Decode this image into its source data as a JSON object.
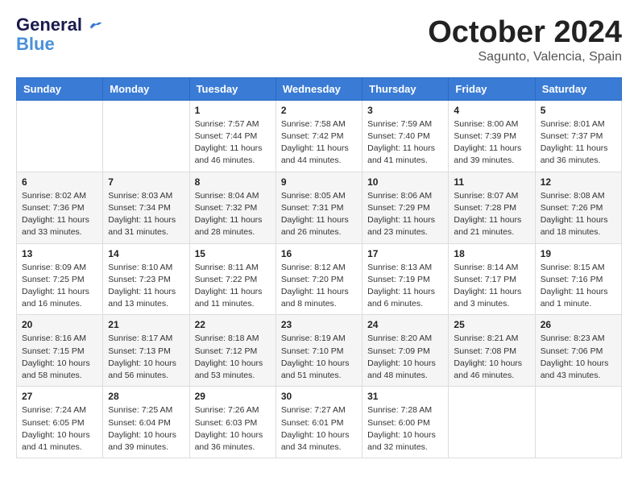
{
  "header": {
    "logo_line1": "General",
    "logo_line2": "Blue",
    "month": "October 2024",
    "location": "Sagunto, Valencia, Spain"
  },
  "weekdays": [
    "Sunday",
    "Monday",
    "Tuesday",
    "Wednesday",
    "Thursday",
    "Friday",
    "Saturday"
  ],
  "weeks": [
    [
      {
        "day": "",
        "info": ""
      },
      {
        "day": "",
        "info": ""
      },
      {
        "day": "1",
        "info": "Sunrise: 7:57 AM\nSunset: 7:44 PM\nDaylight: 11 hours and 46 minutes."
      },
      {
        "day": "2",
        "info": "Sunrise: 7:58 AM\nSunset: 7:42 PM\nDaylight: 11 hours and 44 minutes."
      },
      {
        "day": "3",
        "info": "Sunrise: 7:59 AM\nSunset: 7:40 PM\nDaylight: 11 hours and 41 minutes."
      },
      {
        "day": "4",
        "info": "Sunrise: 8:00 AM\nSunset: 7:39 PM\nDaylight: 11 hours and 39 minutes."
      },
      {
        "day": "5",
        "info": "Sunrise: 8:01 AM\nSunset: 7:37 PM\nDaylight: 11 hours and 36 minutes."
      }
    ],
    [
      {
        "day": "6",
        "info": "Sunrise: 8:02 AM\nSunset: 7:36 PM\nDaylight: 11 hours and 33 minutes."
      },
      {
        "day": "7",
        "info": "Sunrise: 8:03 AM\nSunset: 7:34 PM\nDaylight: 11 hours and 31 minutes."
      },
      {
        "day": "8",
        "info": "Sunrise: 8:04 AM\nSunset: 7:32 PM\nDaylight: 11 hours and 28 minutes."
      },
      {
        "day": "9",
        "info": "Sunrise: 8:05 AM\nSunset: 7:31 PM\nDaylight: 11 hours and 26 minutes."
      },
      {
        "day": "10",
        "info": "Sunrise: 8:06 AM\nSunset: 7:29 PM\nDaylight: 11 hours and 23 minutes."
      },
      {
        "day": "11",
        "info": "Sunrise: 8:07 AM\nSunset: 7:28 PM\nDaylight: 11 hours and 21 minutes."
      },
      {
        "day": "12",
        "info": "Sunrise: 8:08 AM\nSunset: 7:26 PM\nDaylight: 11 hours and 18 minutes."
      }
    ],
    [
      {
        "day": "13",
        "info": "Sunrise: 8:09 AM\nSunset: 7:25 PM\nDaylight: 11 hours and 16 minutes."
      },
      {
        "day": "14",
        "info": "Sunrise: 8:10 AM\nSunset: 7:23 PM\nDaylight: 11 hours and 13 minutes."
      },
      {
        "day": "15",
        "info": "Sunrise: 8:11 AM\nSunset: 7:22 PM\nDaylight: 11 hours and 11 minutes."
      },
      {
        "day": "16",
        "info": "Sunrise: 8:12 AM\nSunset: 7:20 PM\nDaylight: 11 hours and 8 minutes."
      },
      {
        "day": "17",
        "info": "Sunrise: 8:13 AM\nSunset: 7:19 PM\nDaylight: 11 hours and 6 minutes."
      },
      {
        "day": "18",
        "info": "Sunrise: 8:14 AM\nSunset: 7:17 PM\nDaylight: 11 hours and 3 minutes."
      },
      {
        "day": "19",
        "info": "Sunrise: 8:15 AM\nSunset: 7:16 PM\nDaylight: 11 hours and 1 minute."
      }
    ],
    [
      {
        "day": "20",
        "info": "Sunrise: 8:16 AM\nSunset: 7:15 PM\nDaylight: 10 hours and 58 minutes."
      },
      {
        "day": "21",
        "info": "Sunrise: 8:17 AM\nSunset: 7:13 PM\nDaylight: 10 hours and 56 minutes."
      },
      {
        "day": "22",
        "info": "Sunrise: 8:18 AM\nSunset: 7:12 PM\nDaylight: 10 hours and 53 minutes."
      },
      {
        "day": "23",
        "info": "Sunrise: 8:19 AM\nSunset: 7:10 PM\nDaylight: 10 hours and 51 minutes."
      },
      {
        "day": "24",
        "info": "Sunrise: 8:20 AM\nSunset: 7:09 PM\nDaylight: 10 hours and 48 minutes."
      },
      {
        "day": "25",
        "info": "Sunrise: 8:21 AM\nSunset: 7:08 PM\nDaylight: 10 hours and 46 minutes."
      },
      {
        "day": "26",
        "info": "Sunrise: 8:23 AM\nSunset: 7:06 PM\nDaylight: 10 hours and 43 minutes."
      }
    ],
    [
      {
        "day": "27",
        "info": "Sunrise: 7:24 AM\nSunset: 6:05 PM\nDaylight: 10 hours and 41 minutes."
      },
      {
        "day": "28",
        "info": "Sunrise: 7:25 AM\nSunset: 6:04 PM\nDaylight: 10 hours and 39 minutes."
      },
      {
        "day": "29",
        "info": "Sunrise: 7:26 AM\nSunset: 6:03 PM\nDaylight: 10 hours and 36 minutes."
      },
      {
        "day": "30",
        "info": "Sunrise: 7:27 AM\nSunset: 6:01 PM\nDaylight: 10 hours and 34 minutes."
      },
      {
        "day": "31",
        "info": "Sunrise: 7:28 AM\nSunset: 6:00 PM\nDaylight: 10 hours and 32 minutes."
      },
      {
        "day": "",
        "info": ""
      },
      {
        "day": "",
        "info": ""
      }
    ]
  ]
}
